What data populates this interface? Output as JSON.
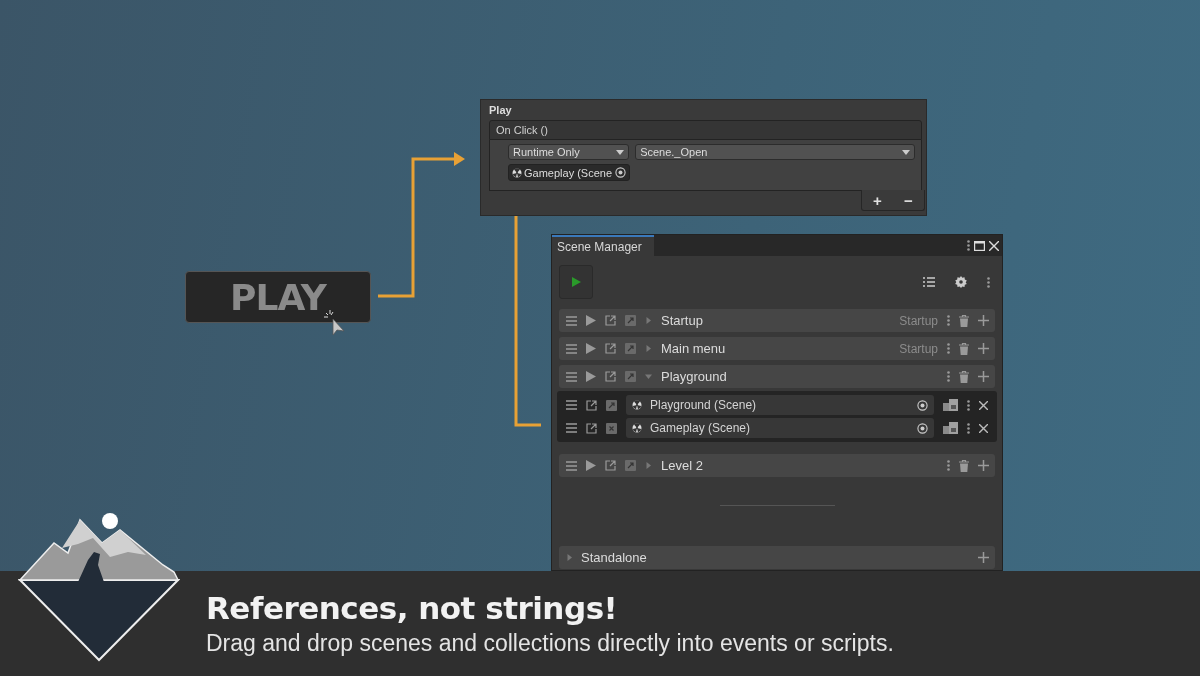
{
  "inspector": {
    "title": "Play",
    "event": "On Click ()",
    "mode": "Runtime Only",
    "function": "Scene._Open",
    "object": "Gameplay (Scene",
    "buttons": [
      "+",
      "−"
    ]
  },
  "play_button": {
    "label": "PLAY"
  },
  "scene_manager": {
    "tab": "Scene Manager",
    "collections": [
      {
        "name": "Startup",
        "tag": "Startup",
        "expanded": false
      },
      {
        "name": "Main menu",
        "tag": "Startup",
        "expanded": false
      },
      {
        "name": "Playground",
        "expanded": true,
        "scenes": [
          {
            "name": "Playground (Scene)"
          },
          {
            "name": "Gameplay (Scene)"
          }
        ]
      },
      {
        "name": "Level 2",
        "expanded": false
      }
    ],
    "standalone": "Standalone"
  },
  "banner": {
    "title": "References, not strings!",
    "subtitle": "Drag and drop scenes and collections directly into events or scripts."
  }
}
